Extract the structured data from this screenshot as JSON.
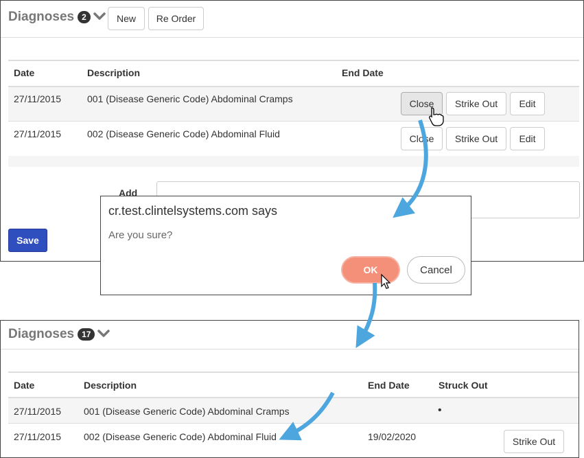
{
  "top_panel": {
    "title": "Diagnoses",
    "count": "2",
    "new_label": "New",
    "reorder_label": "Re Order",
    "columns": {
      "date": "Date",
      "description": "Description",
      "end_date": "End Date"
    },
    "rows": [
      {
        "date": "27/11/2015",
        "description": "001 (Disease Generic Code) Abdominal Cramps",
        "close_label": "Close",
        "strike_label": "Strike Out",
        "edit_label": "Edit"
      },
      {
        "date": "27/11/2015",
        "description": "002 (Disease Generic Code) Abdominal Fluid",
        "close_label": "Close",
        "strike_label": "Strike Out",
        "edit_label": "Edit"
      }
    ],
    "add_label": "Add",
    "save_label": "Save"
  },
  "dialog": {
    "title": "cr.test.clintelsystems.com says",
    "message": "Are you sure?",
    "ok_label": "OK",
    "cancel_label": "Cancel"
  },
  "bottom_panel": {
    "title": "Diagnoses",
    "count": "17",
    "columns": {
      "date": "Date",
      "description": "Description",
      "end_date": "End Date",
      "struck_out": "Struck Out"
    },
    "rows": [
      {
        "date": "27/11/2015",
        "description": "001 (Disease Generic Code) Abdominal Cramps",
        "end_date": "",
        "struck_out": "•"
      },
      {
        "date": "27/11/2015",
        "description": "002 (Disease Generic Code) Abdominal Fluid",
        "end_date": "19/02/2020",
        "struck_out": "",
        "strike_label": "Strike Out"
      }
    ]
  },
  "colors": {
    "save": "#2f4fbf",
    "ok": "#f4907a",
    "arrow": "#4ea6df"
  },
  "icons": [
    "chevron-down-icon",
    "hand-cursor-icon",
    "arrow-cursor-icon",
    "flow-arrow-icon"
  ]
}
